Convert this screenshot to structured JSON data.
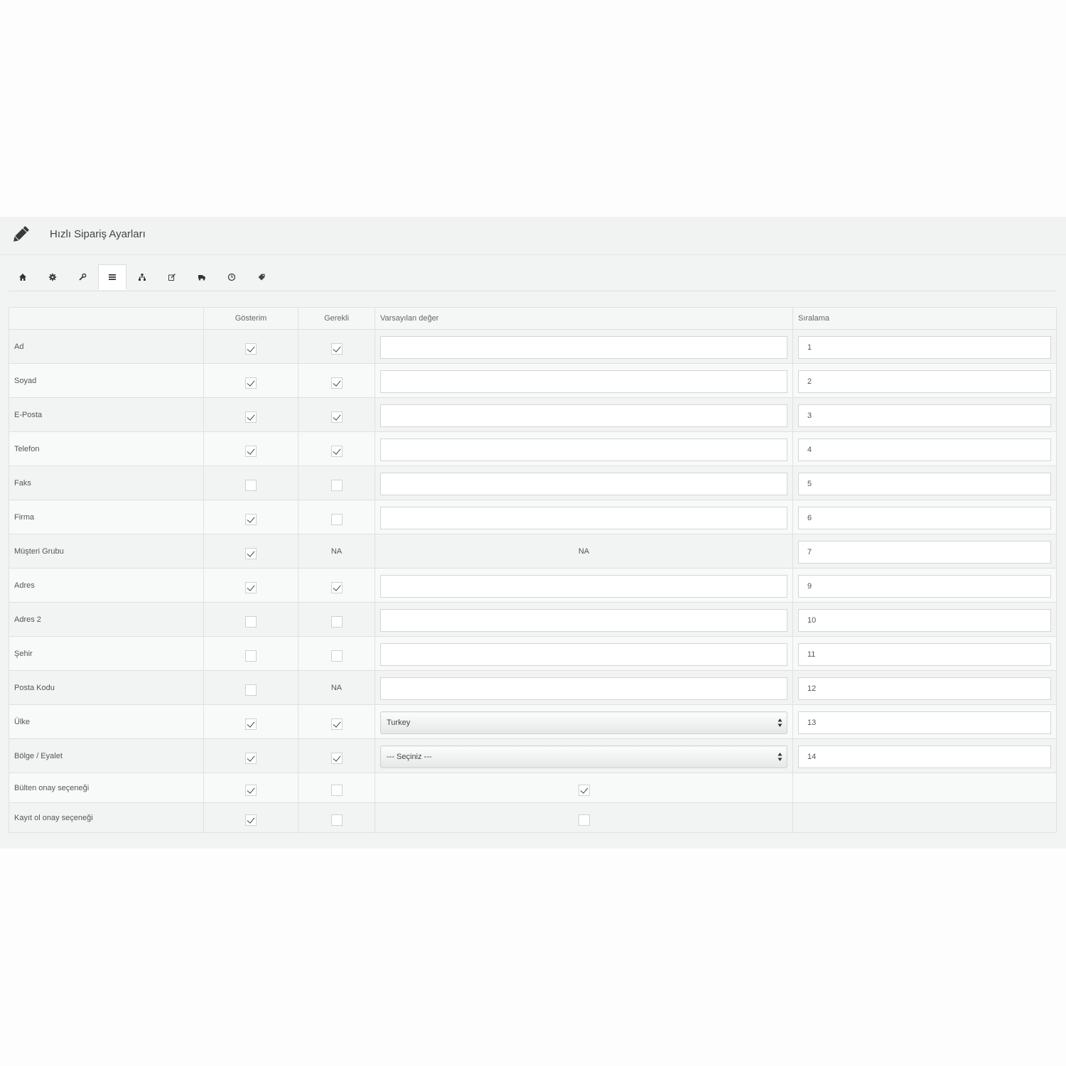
{
  "panel": {
    "title": "Hızlı Sipariş Ayarları"
  },
  "tabs": [
    {
      "icon": "home-icon",
      "active": false
    },
    {
      "icon": "gear-icon",
      "active": false
    },
    {
      "icon": "wrench-icon",
      "active": false
    },
    {
      "icon": "list-icon",
      "active": true
    },
    {
      "icon": "sitemap-icon",
      "active": false
    },
    {
      "icon": "edit-icon",
      "active": false
    },
    {
      "icon": "truck-icon",
      "active": false
    },
    {
      "icon": "clock-icon",
      "active": false
    },
    {
      "icon": "tags-icon",
      "active": false
    }
  ],
  "table": {
    "headers": {
      "field": "",
      "show": "Gösterim",
      "required": "Gerekli",
      "default": "Varsayılan değer",
      "order": "Sıralama"
    },
    "rows": [
      {
        "label": "Ad",
        "show": true,
        "required": true,
        "default_type": "text",
        "default_value": "",
        "order": "1"
      },
      {
        "label": "Soyad",
        "show": true,
        "required": true,
        "default_type": "text",
        "default_value": "",
        "order": "2"
      },
      {
        "label": "E-Posta",
        "show": true,
        "required": true,
        "default_type": "text",
        "default_value": "",
        "order": "3"
      },
      {
        "label": "Telefon",
        "show": true,
        "required": true,
        "default_type": "text",
        "default_value": "",
        "order": "4"
      },
      {
        "label": "Faks",
        "show": false,
        "required": false,
        "default_type": "text",
        "default_value": "",
        "order": "5"
      },
      {
        "label": "Firma",
        "show": true,
        "required": false,
        "default_type": "text",
        "default_value": "",
        "order": "6"
      },
      {
        "label": "Müşteri Grubu",
        "show": true,
        "required": "NA",
        "default_type": "na",
        "default_value": "NA",
        "order": "7"
      },
      {
        "label": "Adres",
        "show": true,
        "required": true,
        "default_type": "text",
        "default_value": "",
        "order": "9"
      },
      {
        "label": "Adres 2",
        "show": false,
        "required": false,
        "default_type": "text",
        "default_value": "",
        "order": "10"
      },
      {
        "label": "Şehir",
        "show": false,
        "required": false,
        "default_type": "text",
        "default_value": "",
        "order": "11"
      },
      {
        "label": "Posta Kodu",
        "show": false,
        "required": "NA",
        "default_type": "text",
        "default_value": "",
        "order": "12"
      },
      {
        "label": "Ülke",
        "show": true,
        "required": true,
        "default_type": "select",
        "default_value": "Turkey",
        "order": "13"
      },
      {
        "label": "Bölge / Eyalet",
        "show": true,
        "required": true,
        "default_type": "select",
        "default_value": "--- Seçiniz ---",
        "order": "14"
      },
      {
        "label": "Bülten onay seçeneği",
        "show": true,
        "required": false,
        "default_type": "checkbox",
        "default_value": true,
        "order": null
      },
      {
        "label": "Kayıt ol onay seçeneği",
        "show": true,
        "required": false,
        "default_type": "checkbox",
        "default_value": false,
        "order": null
      }
    ]
  }
}
